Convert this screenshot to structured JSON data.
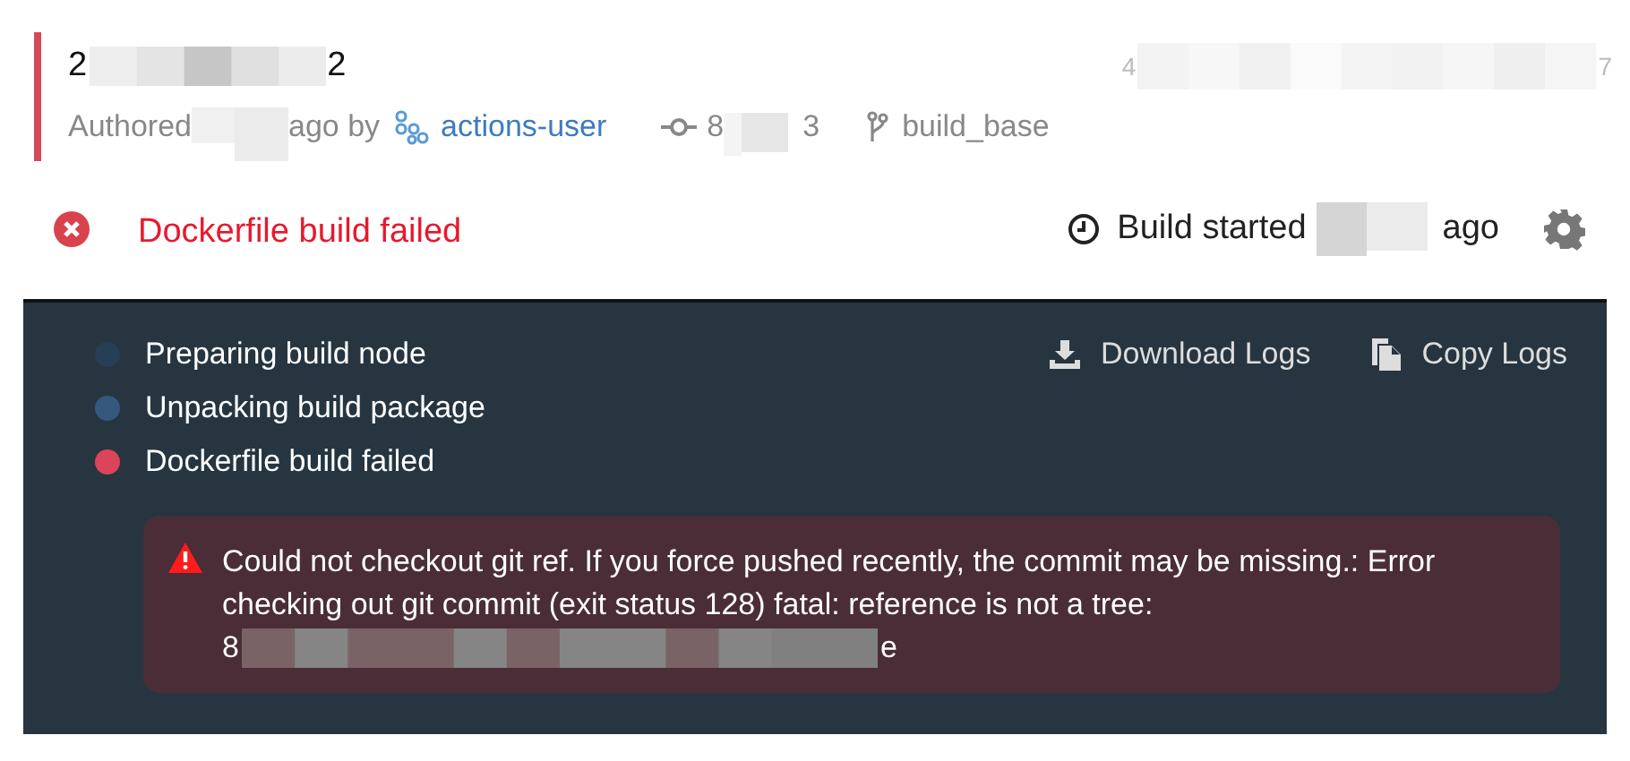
{
  "commit": {
    "title_parts": [
      "2",
      "2"
    ],
    "hash_parts": [
      "4",
      "7"
    ],
    "authored_parts": [
      "Authored",
      "ago by"
    ],
    "author": "actions-user",
    "commit_ref_parts": [
      "8",
      "3"
    ],
    "branch": "build_base"
  },
  "status": {
    "kind": "failed",
    "text": "Dockerfile build failed",
    "started_parts": [
      "Build started",
      "ago"
    ]
  },
  "log": {
    "actions": [
      "Download Logs",
      "Copy Logs"
    ],
    "steps": [
      {
        "label": "Preparing build node",
        "color": "#263f57"
      },
      {
        "label": "Unpacking build package",
        "color": "#36587d"
      },
      {
        "label": "Dockerfile build failed",
        "color": "#dc4459"
      }
    ],
    "error": {
      "text": "Could not checkout git ref. If you force pushed recently, the commit may be missing.: Error checking out git commit (exit status 128) fatal: reference is not a tree:",
      "ref_parts": [
        "8",
        "e"
      ]
    }
  }
}
